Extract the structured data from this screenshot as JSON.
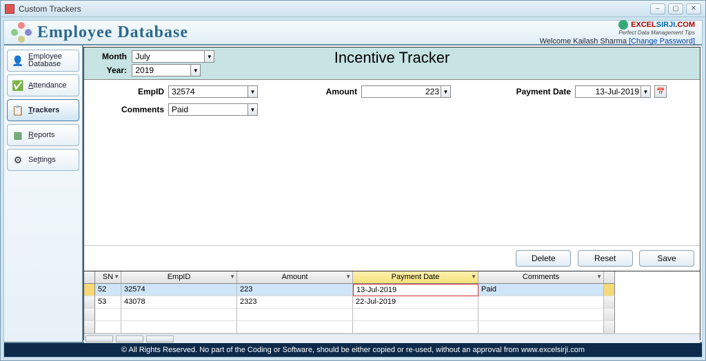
{
  "window": {
    "title": "Custom Trackers"
  },
  "header": {
    "app_title": "Employee Database",
    "brand1": "EXCEL",
    "brand2": "SIRJI",
    "brand3": ".COM",
    "tagline": "Perfect Data Management Tips",
    "welcome_prefix": "Welcome ",
    "welcome_user": "Kailash Sharma",
    "change_pw": "[Change Password]"
  },
  "nav": {
    "emp_l1": "Employee",
    "emp_l2": "Database",
    "attendance": "Attendance",
    "trackers": "Trackers",
    "reports": "Reports",
    "settings": "Settings"
  },
  "filter": {
    "month_label": "Month",
    "month_value": "July",
    "year_label": "Year:",
    "year_value": "2019",
    "page_title": "Incentive Tracker"
  },
  "form": {
    "empid_label": "EmpID",
    "empid_value": "32574",
    "amount_label": "Amount",
    "amount_value": "223",
    "payment_label": "Payment Date",
    "payment_value": "13-Jul-2019",
    "comments_label": "Comments",
    "comments_value": "Paid"
  },
  "actions": {
    "delete": "Delete",
    "reset": "Reset",
    "save": "Save"
  },
  "grid": {
    "headers": {
      "sn": "SN",
      "empid": "EmpID",
      "amount": "Amount",
      "payment": "Payment Date",
      "comments": "Comments"
    },
    "rows": [
      {
        "sn": "52",
        "empid": "32574",
        "amount": "223",
        "payment": "13-Jul-2019",
        "comments": "Paid",
        "selected": true,
        "editing_payment": true
      },
      {
        "sn": "53",
        "empid": "43078",
        "amount": "2323",
        "payment": "22-Jul-2019",
        "comments": ""
      }
    ]
  },
  "footer": "© All Rights Reserved. No part of the Coding or Software, should be either copied or re-used, without an approval from www.excelsirji.com"
}
